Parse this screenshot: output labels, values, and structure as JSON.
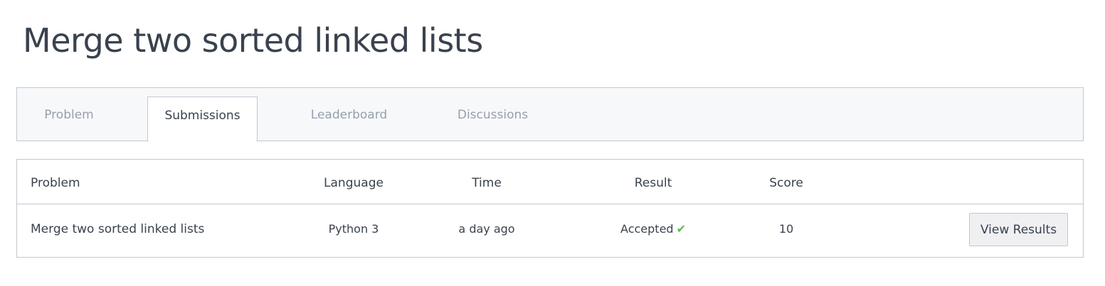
{
  "page": {
    "title": "Merge two sorted linked lists"
  },
  "tabs": [
    {
      "label": "Problem",
      "active": false
    },
    {
      "label": "Submissions",
      "active": true
    },
    {
      "label": "Leaderboard",
      "active": false
    },
    {
      "label": "Discussions",
      "active": false
    }
  ],
  "table": {
    "headers": {
      "problem": "Problem",
      "language": "Language",
      "time": "Time",
      "result": "Result",
      "score": "Score"
    },
    "rows": [
      {
        "problem": "Merge two sorted linked lists",
        "language": "Python 3",
        "time": "a day ago",
        "result": "Accepted",
        "result_icon": "check-icon",
        "score": "10",
        "action": "View Results"
      }
    ]
  },
  "colors": {
    "accent": "#5b8def",
    "success": "#5cb85c",
    "text": "#39424e",
    "muted": "#979faf"
  }
}
